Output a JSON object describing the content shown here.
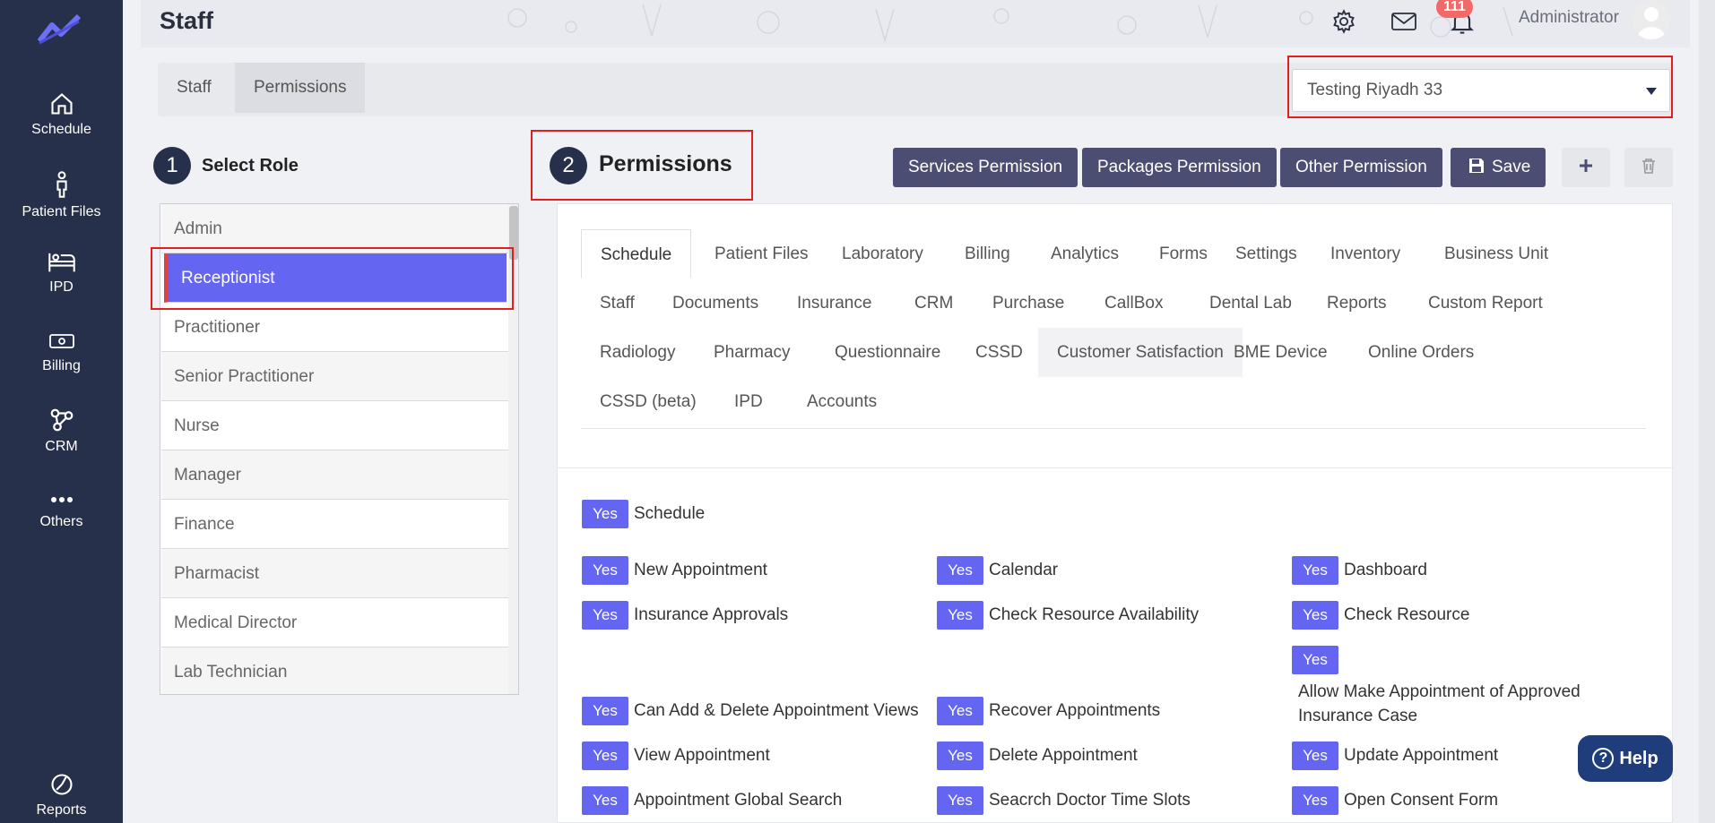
{
  "header": {
    "title": "Staff",
    "notification_count": "111",
    "user_name": "Administrator"
  },
  "sidebar": {
    "items": [
      {
        "label": "Schedule",
        "icon": "home-icon"
      },
      {
        "label": "Patient Files",
        "icon": "person-icon"
      },
      {
        "label": "IPD",
        "icon": "bed-icon"
      },
      {
        "label": "Billing",
        "icon": "money-icon"
      },
      {
        "label": "CRM",
        "icon": "nodes-icon"
      },
      {
        "label": "Others",
        "icon": "more-icon"
      },
      {
        "label": "Reports",
        "icon": "pie-icon"
      }
    ]
  },
  "tabs": [
    "Staff",
    "Permissions"
  ],
  "branch": {
    "selected": "Testing Riyadh 33"
  },
  "steps": {
    "step1": {
      "number": "1",
      "label": "Select Role"
    },
    "step2": {
      "number": "2",
      "label": "Permissions"
    }
  },
  "actions": {
    "services": "Services Permission",
    "packages": "Packages Permission",
    "other": "Other Permission",
    "save": "Save"
  },
  "roles": [
    "Admin",
    "Receptionist",
    "Practitioner",
    "Senior Practitioner",
    "Nurse",
    "Manager",
    "Finance",
    "Pharmacist",
    "Medical Director",
    "Lab Technician"
  ],
  "module_tabs": [
    [
      "Schedule",
      "Patient Files",
      "Laboratory",
      "Billing",
      "Analytics",
      "Forms",
      "Settings",
      "Inventory",
      "Business Unit"
    ],
    [
      "Staff",
      "Documents",
      "Insurance",
      "CRM",
      "Purchase",
      "CallBox",
      "Dental Lab",
      "Reports",
      "Custom Report"
    ],
    [
      "Radiology",
      "Pharmacy",
      "Questionnaire",
      "CSSD",
      "Customer Satisfaction",
      "BME Device",
      "Online Orders"
    ],
    [
      "CSSD (beta)",
      "IPD",
      "Accounts"
    ]
  ],
  "permissions": {
    "yes_label": "Yes",
    "main": "Schedule",
    "items": [
      "New Appointment",
      "Calendar",
      "Dashboard",
      "Insurance Approvals",
      "Check Resource Availability",
      "Check Resource",
      "Allow Make Appointment of Approved Insurance Case",
      "Can Add & Delete Appointment Views",
      "Recover Appointments",
      "View Appointment",
      "Delete Appointment",
      "Update Appointment",
      "Appointment Global Search",
      "Seacrch Doctor Time Slots",
      "Open Consent Form"
    ]
  },
  "help": "Help"
}
